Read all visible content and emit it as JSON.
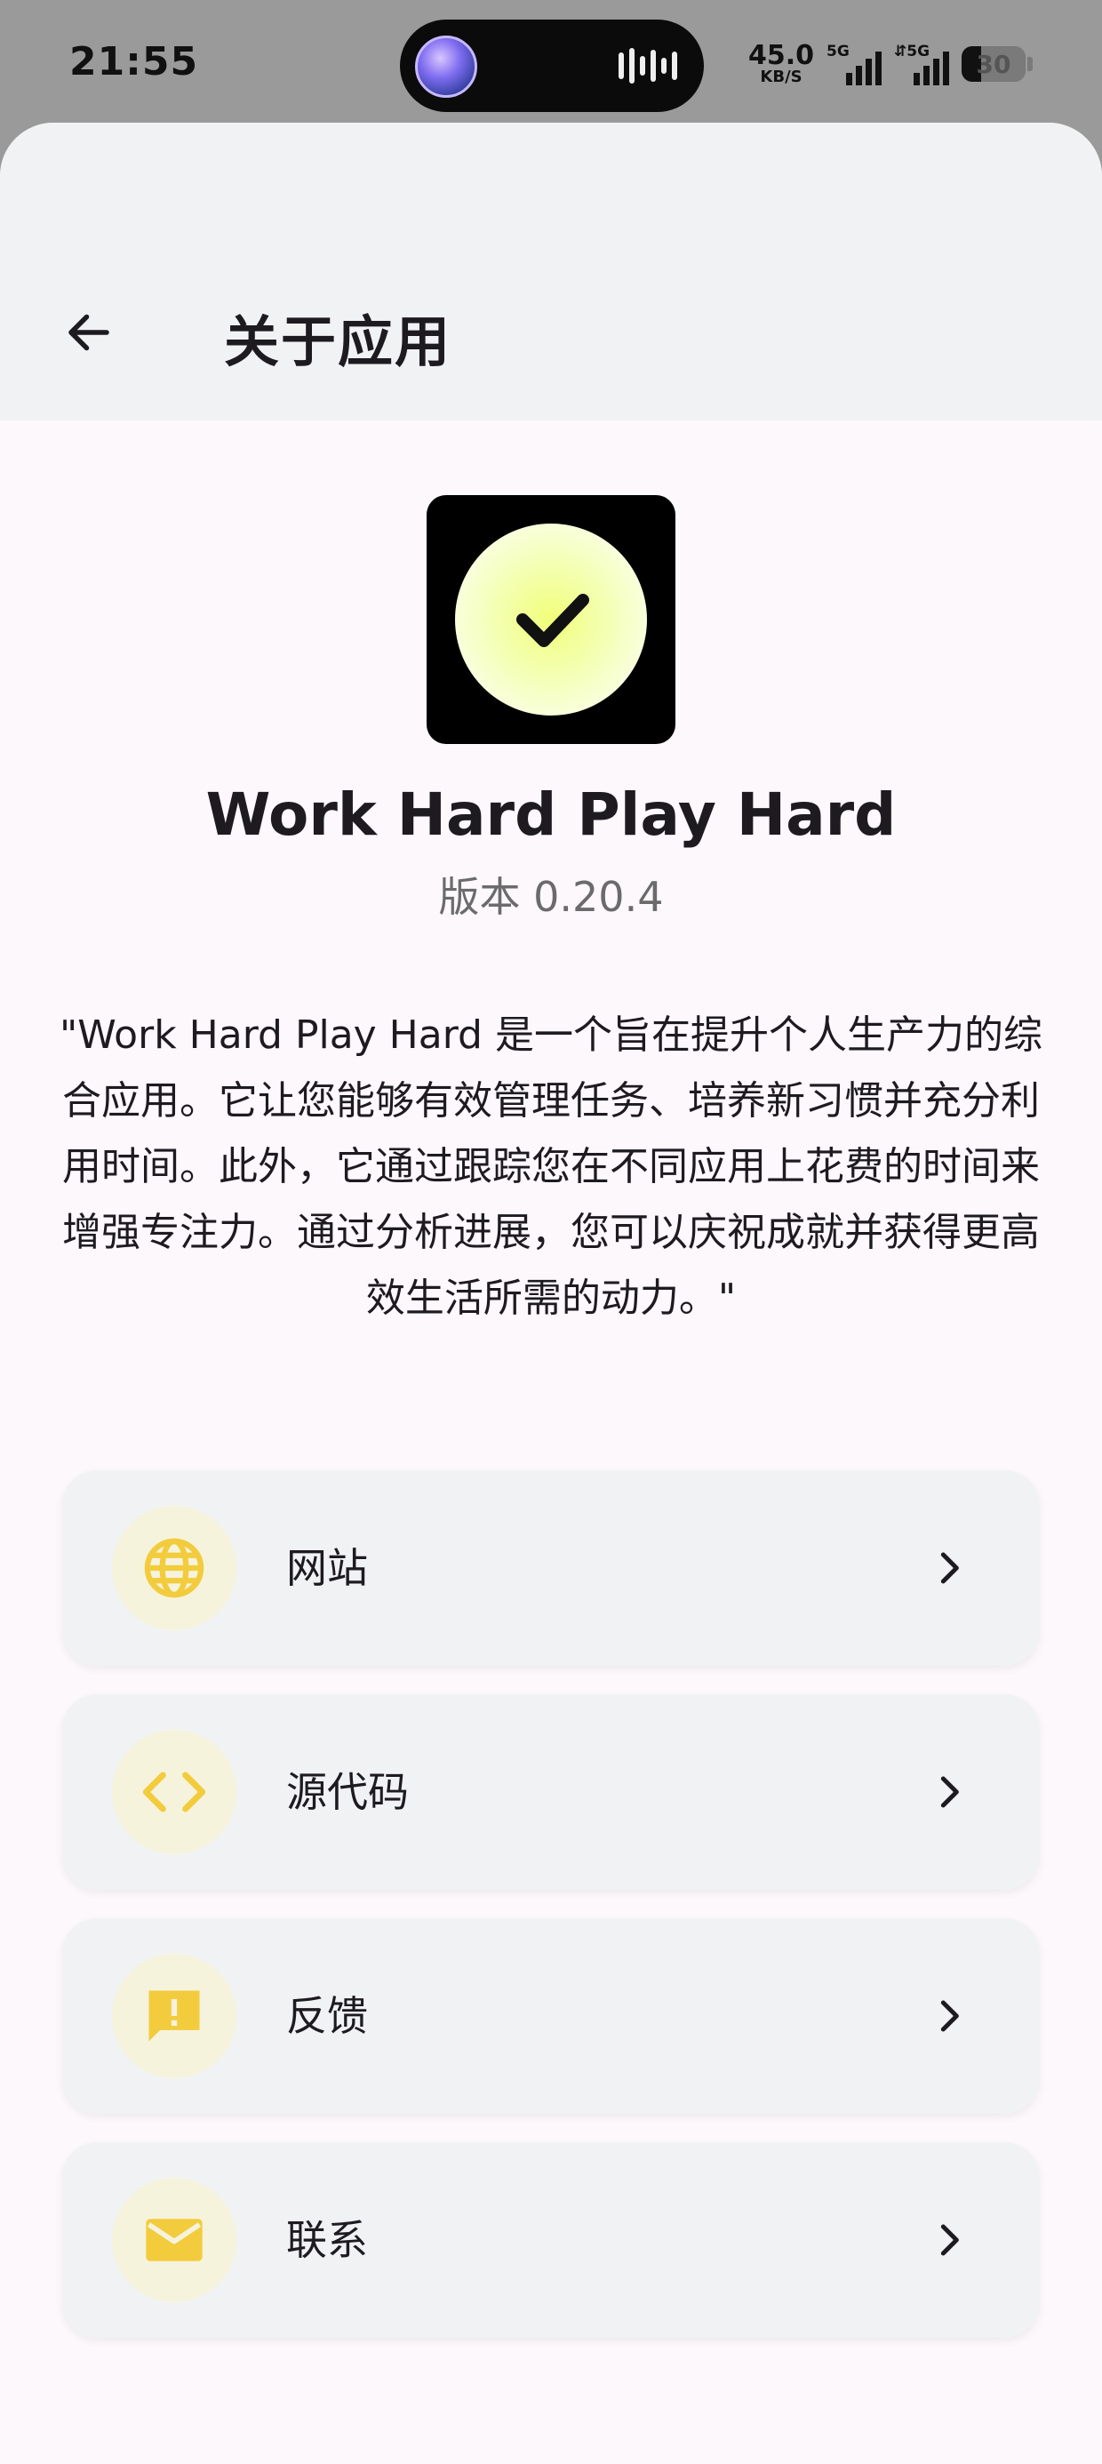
{
  "status_bar": {
    "time": "21:55",
    "net_speed_value": "45.0",
    "net_speed_unit": "KB/S",
    "sim1_tag": "5G",
    "sim2_tag": "5G",
    "battery_level": "30"
  },
  "header": {
    "back_icon": "arrow-left-icon",
    "title": "关于应用"
  },
  "app": {
    "icon": "checkmark-icon",
    "name": "Work Hard Play Hard",
    "version": "版本 0.20.4",
    "description": "\"Work Hard Play Hard 是一个旨在提升个人生产力的综合应用。它让您能够有效管理任务、培养新习惯并充分利用时间。此外，它通过跟踪您在不同应用上花费的时间来增强专注力。通过分析进展，您可以庆祝成就并获得更高效生活所需的动力。\""
  },
  "links": [
    {
      "label": "网站",
      "icon": "globe-icon"
    },
    {
      "label": "源代码",
      "icon": "code-icon"
    },
    {
      "label": "反馈",
      "icon": "feedback-icon"
    },
    {
      "label": "联系",
      "icon": "mail-icon"
    }
  ],
  "colors": {
    "accent": "#f2cc3d",
    "icon_bg": "#f6f3dd",
    "card_bg": "#f1f2f3",
    "page_bg": "#fcf8fc"
  }
}
